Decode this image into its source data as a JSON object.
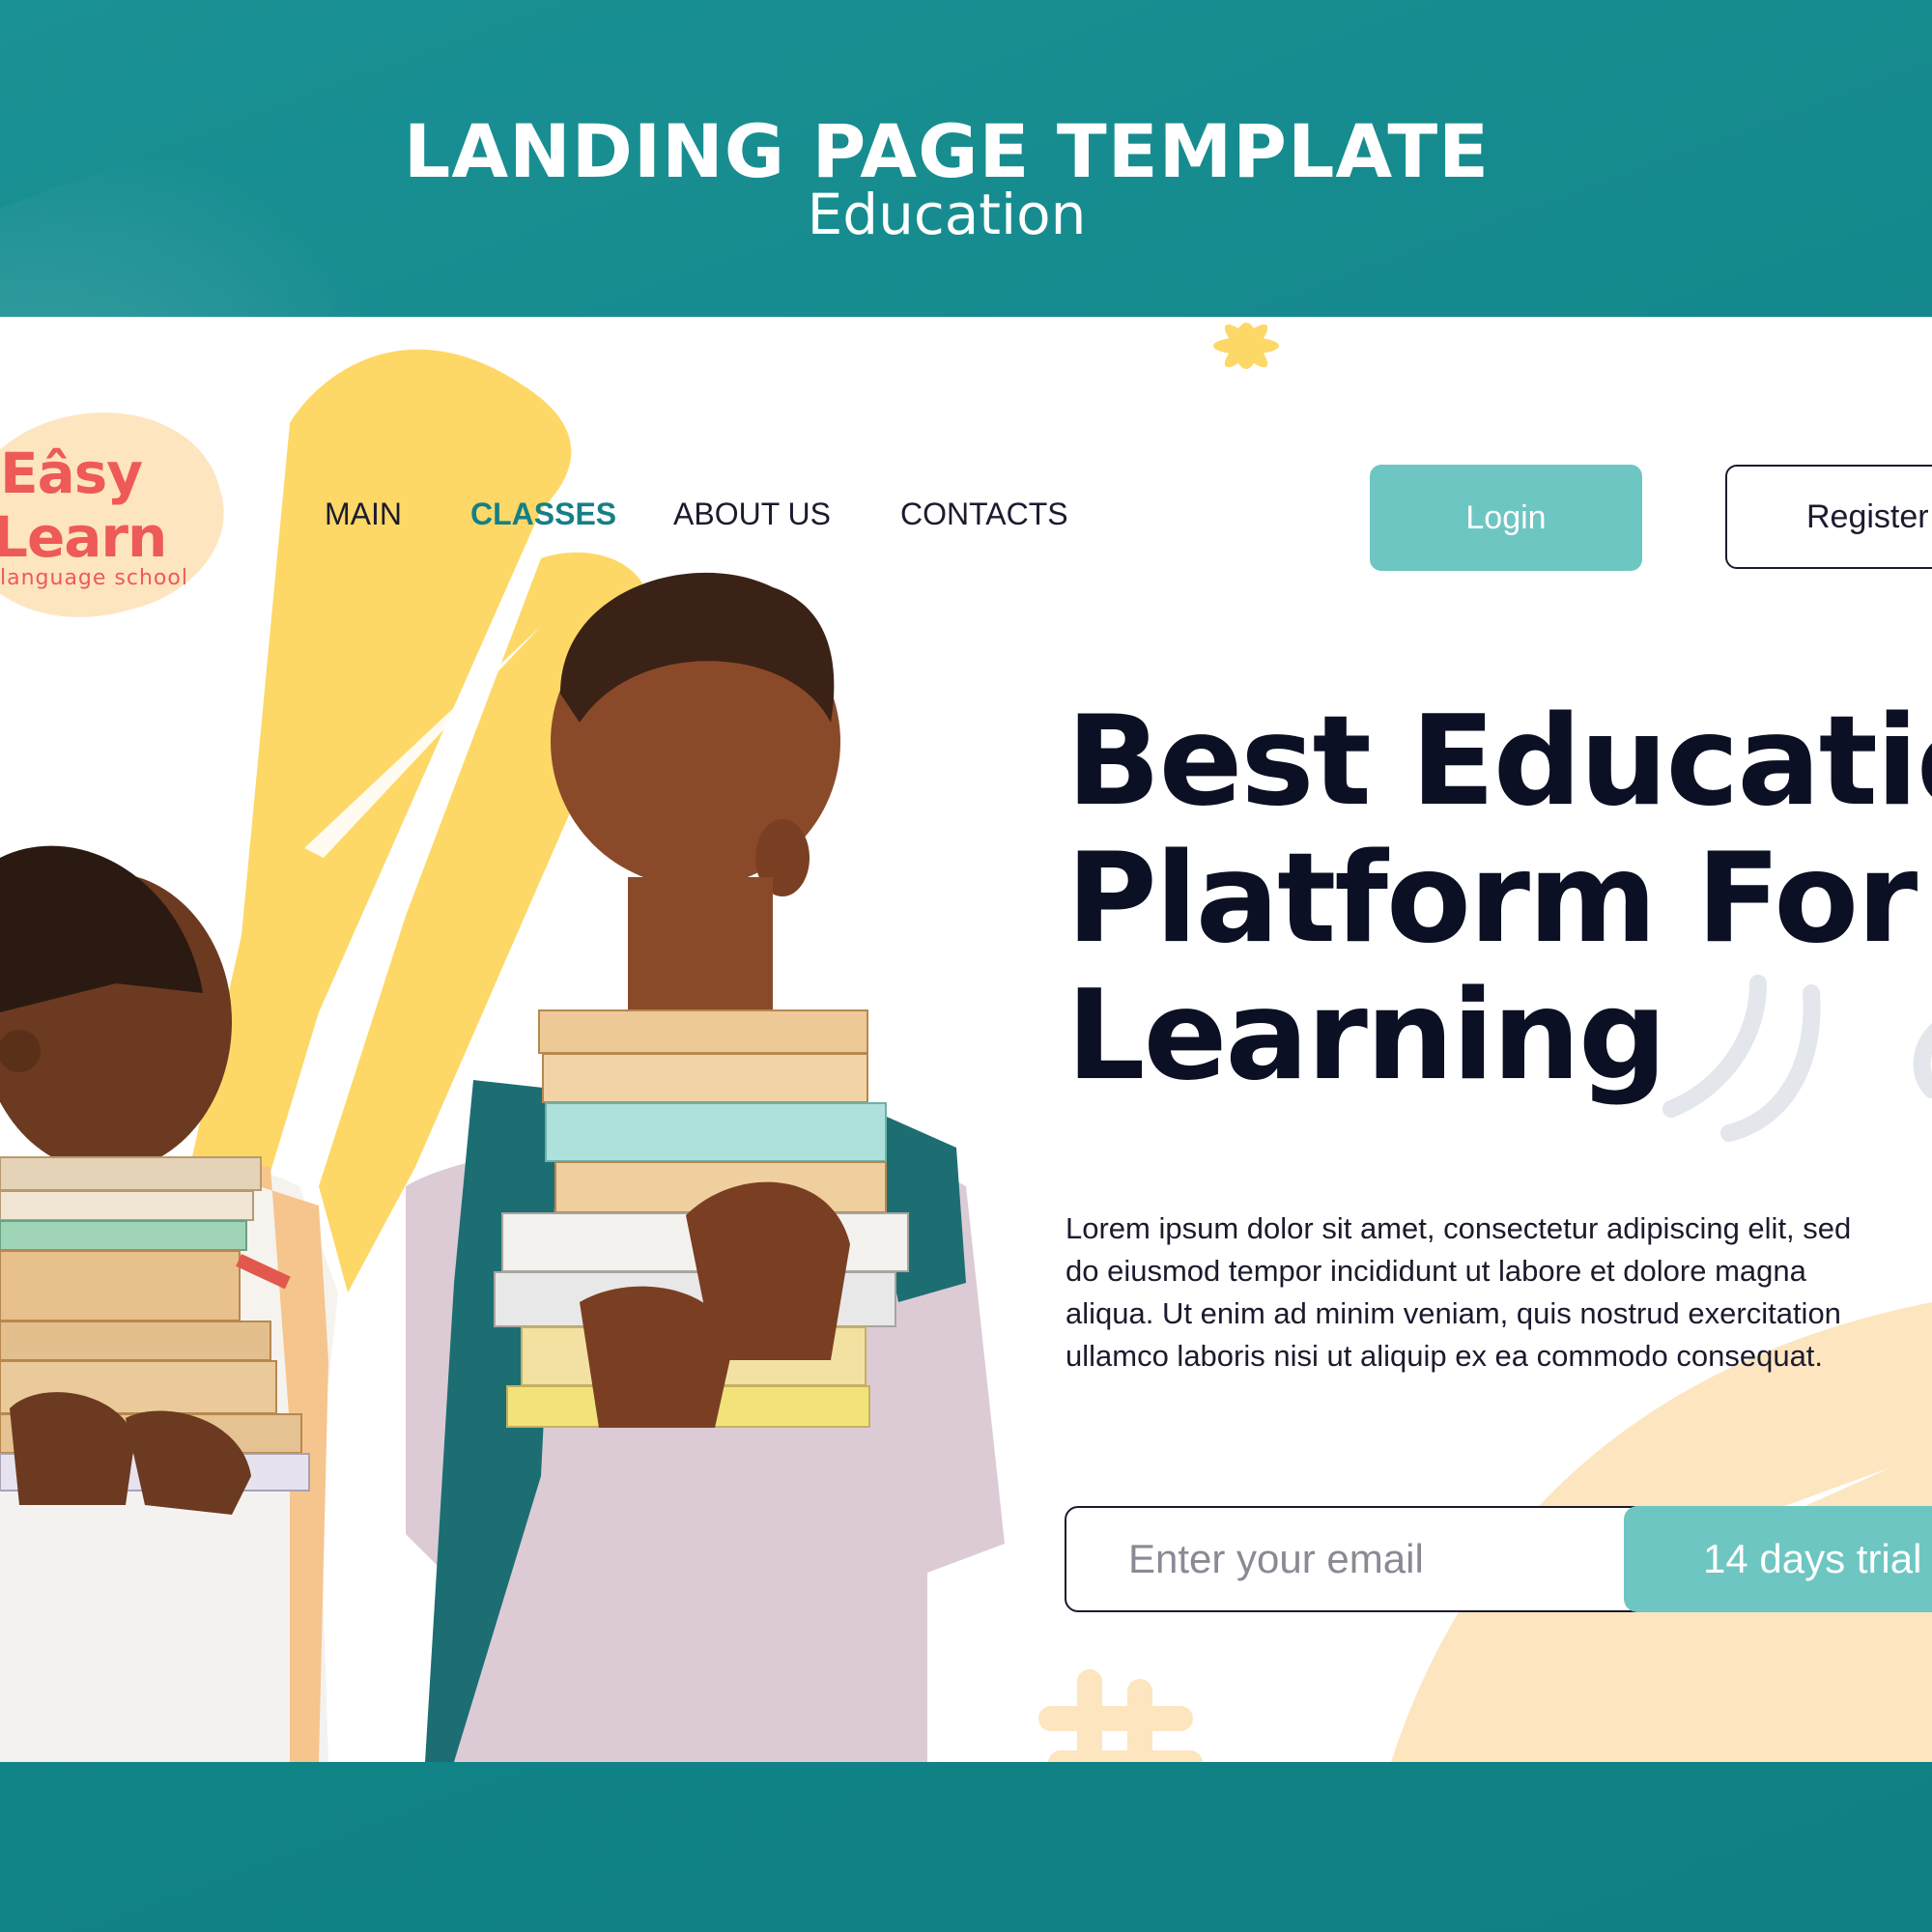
{
  "header": {
    "title": "LANDING PAGE TEMPLATE",
    "subtitle": "Education"
  },
  "logo": {
    "line1": "Eâsy",
    "line2": "Learn",
    "tagline": "language school"
  },
  "nav": {
    "items": [
      "MAIN",
      "CLASSES",
      "ABOUT US",
      "CONTACTS"
    ],
    "active": "CLASSES"
  },
  "auth": {
    "login_label": "Login",
    "register_label": "Register"
  },
  "hero": {
    "title_lines": [
      "Best Education",
      "Platform For",
      "Learning"
    ],
    "body": "Lorem ipsum dolor sit amet, consectetur adipiscing elit, sed do eiusmod tempor incididunt ut labore et dolore magna aliqua. Ut enim ad minim veniam, quis nostrud exercitation ullamco laboris nisi ut aliquip ex ea commodo consequat.",
    "email_placeholder": "Enter your email",
    "cta_label": "14 days trial"
  },
  "colors": {
    "background": "#13888c",
    "accent": "#6ec6c2",
    "nav_active": "#167f85",
    "logo": "#ee5a57",
    "yellow": "#fdd867",
    "peach": "#fde5bf",
    "text_dark": "#0c1024"
  },
  "icons": [
    "asterisk-decoration-icon",
    "arc-lines-decoration-icon",
    "hash-decoration-icon"
  ]
}
